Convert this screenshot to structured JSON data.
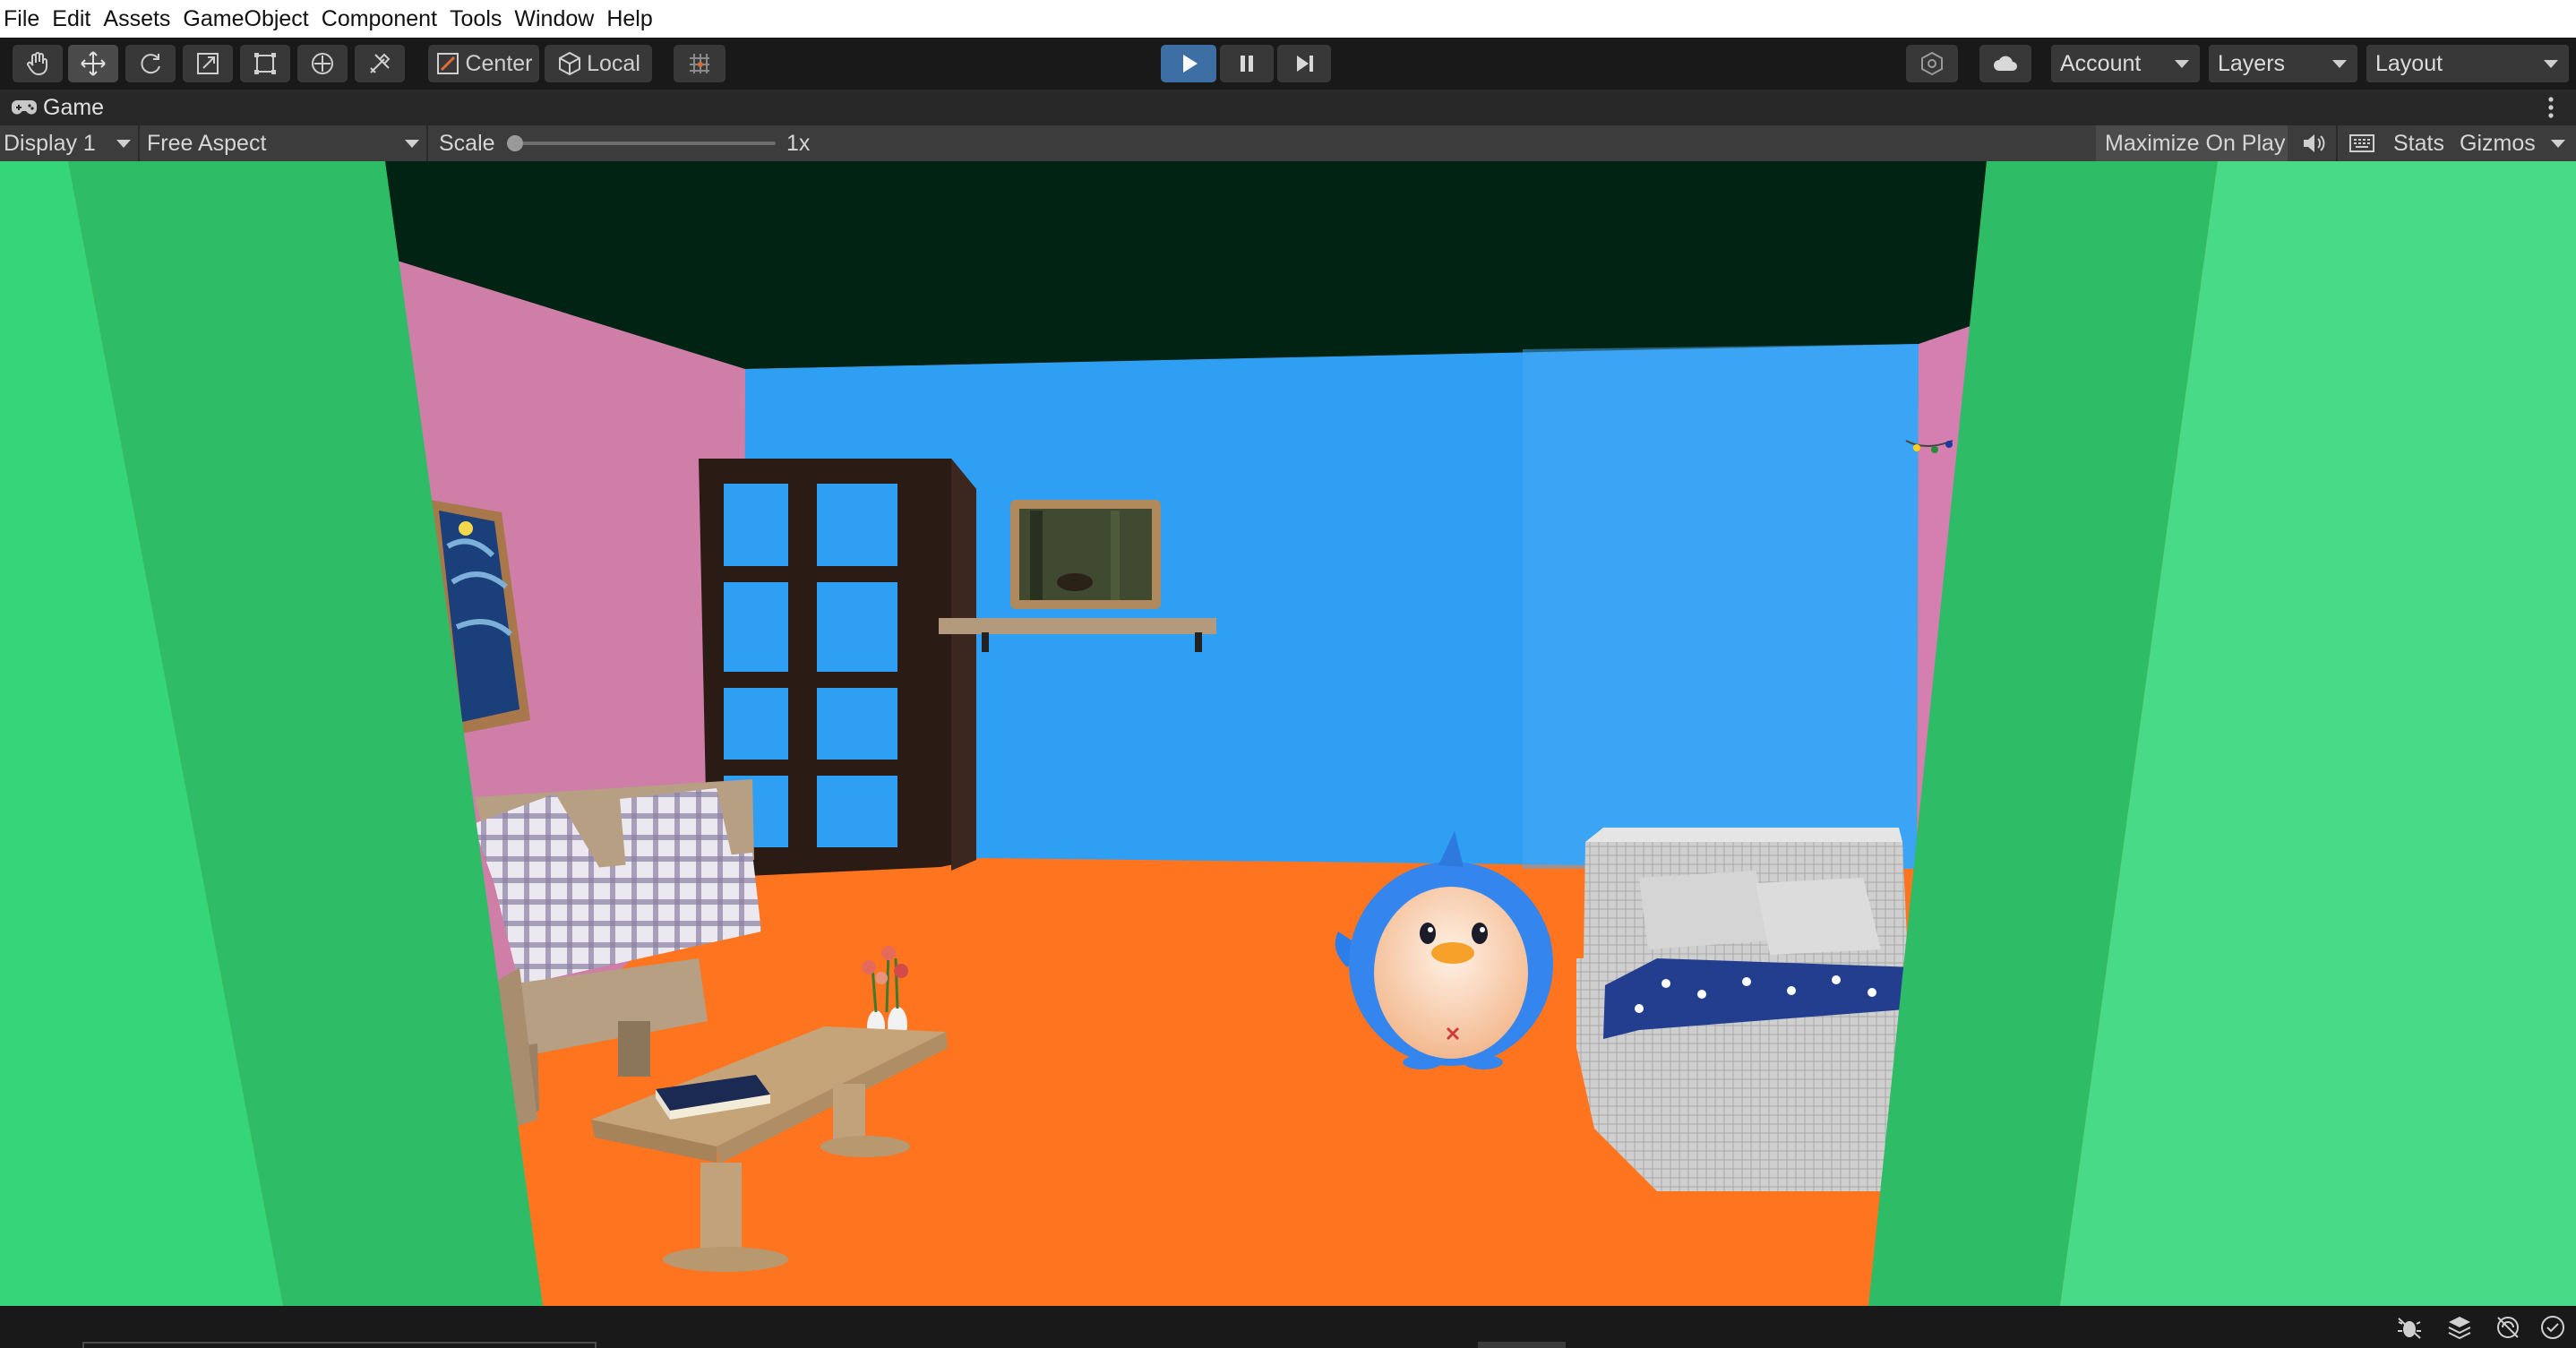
{
  "menu": [
    "File",
    "Edit",
    "Assets",
    "GameObject",
    "Component",
    "Tools",
    "Window",
    "Help"
  ],
  "toolbar": {
    "tools": [
      "hand-tool-icon",
      "move-tool-icon",
      "rotate-tool-icon",
      "scale-tool-icon",
      "rect-tool-icon",
      "transform-tool-icon",
      "custom-tool-icon"
    ],
    "pivot_label": "Center",
    "space_label": "Local",
    "account_label": "Account",
    "layers_label": "Layers",
    "layout_label": "Layout",
    "accent_color": "#3d6fa5"
  },
  "game_tab": {
    "title": "Game"
  },
  "game_toolbar": {
    "display": "Display 1",
    "aspect": "Free Aspect",
    "scale_label": "Scale",
    "scale_value": "1x",
    "scale_level": 0.0,
    "maximize_label": "Maximize On Play",
    "stats_label": "Stats",
    "gizmos_label": "Gizmos"
  },
  "scene_colors": {
    "green_wall": "#34d679",
    "ceiling": "#002314",
    "back_wall": "#2f9ff3",
    "side_wall": "#ce7ea7",
    "floor": "#ff741f"
  },
  "status_icons": [
    "debug-icon",
    "layers-status-icon",
    "network-status-icon",
    "check-circle-icon"
  ]
}
